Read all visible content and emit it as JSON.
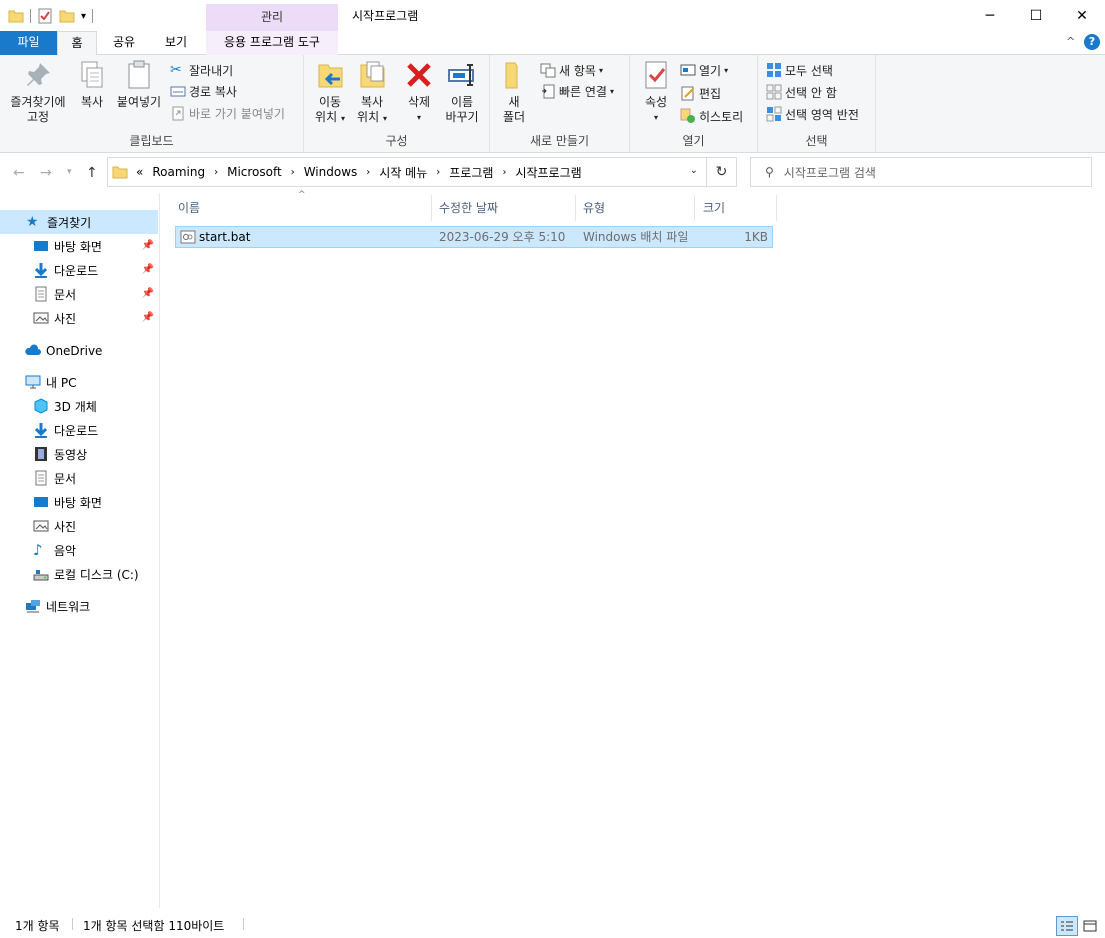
{
  "window": {
    "title": "시작프로그램",
    "context_tab_header": "관리",
    "minimize": "─",
    "maximize": "☐",
    "close": "✕"
  },
  "tabs": [
    {
      "label": "파일"
    },
    {
      "label": "홈"
    },
    {
      "label": "공유"
    },
    {
      "label": "보기"
    },
    {
      "label": "응용 프로그램 도구"
    }
  ],
  "ribbon": {
    "clipboard": {
      "label": "클립보드",
      "pin_line1": "즐겨찾기에",
      "pin_line2": "고정",
      "copy": "복사",
      "paste": "붙여넣기",
      "cut": "잘라내기",
      "copy_path": "경로 복사",
      "paste_shortcut": "바로 가기 붙여넣기"
    },
    "organize": {
      "label": "구성",
      "move_line1": "이동",
      "move_line2": "위치",
      "copyto_line1": "복사",
      "copyto_line2": "위치",
      "delete_line1": "삭제",
      "rename_line1": "이름",
      "rename_line2": "바꾸기"
    },
    "new": {
      "label": "새로 만들기",
      "folder_line1": "새",
      "folder_line2": "폴더",
      "new_item": "새 항목",
      "easy_access": "빠른 연결"
    },
    "open": {
      "label": "열기",
      "properties": "속성",
      "open": "열기",
      "edit": "편집",
      "history": "히스토리"
    },
    "select": {
      "label": "선택",
      "select_all": "모두 선택",
      "select_none": "선택 안 함",
      "invert": "선택 영역 반전"
    }
  },
  "address": {
    "overflow": "«",
    "crumbs": [
      "Roaming",
      "Microsoft",
      "Windows",
      "시작 메뉴",
      "프로그램",
      "시작프로그램"
    ],
    "search_placeholder": "시작프로그램 검색"
  },
  "navpane": {
    "quick_access": "즐겨찾기",
    "quick_items": [
      "바탕 화면",
      "다운로드",
      "문서",
      "사진"
    ],
    "onedrive": "OneDrive",
    "this_pc": "내 PC",
    "pc_items": [
      "3D 개체",
      "다운로드",
      "동영상",
      "문서",
      "바탕 화면",
      "사진",
      "음악",
      "로컬 디스크 (C:)"
    ],
    "network": "네트워크"
  },
  "columns": [
    "이름",
    "수정한 날짜",
    "유형",
    "크기"
  ],
  "files": [
    {
      "name": "start.bat",
      "modified": "2023-06-29 오후 5:10",
      "type": "Windows 배치 파일",
      "size": "1KB"
    }
  ],
  "status": {
    "count": "1개 항목",
    "selected": "1개 항목 선택함 110바이트"
  },
  "colors": {
    "file_tab": "#1979ca",
    "context_tab": "#eddcf7",
    "selection": "#cce8ff",
    "selection_border": "#99d1ff"
  }
}
